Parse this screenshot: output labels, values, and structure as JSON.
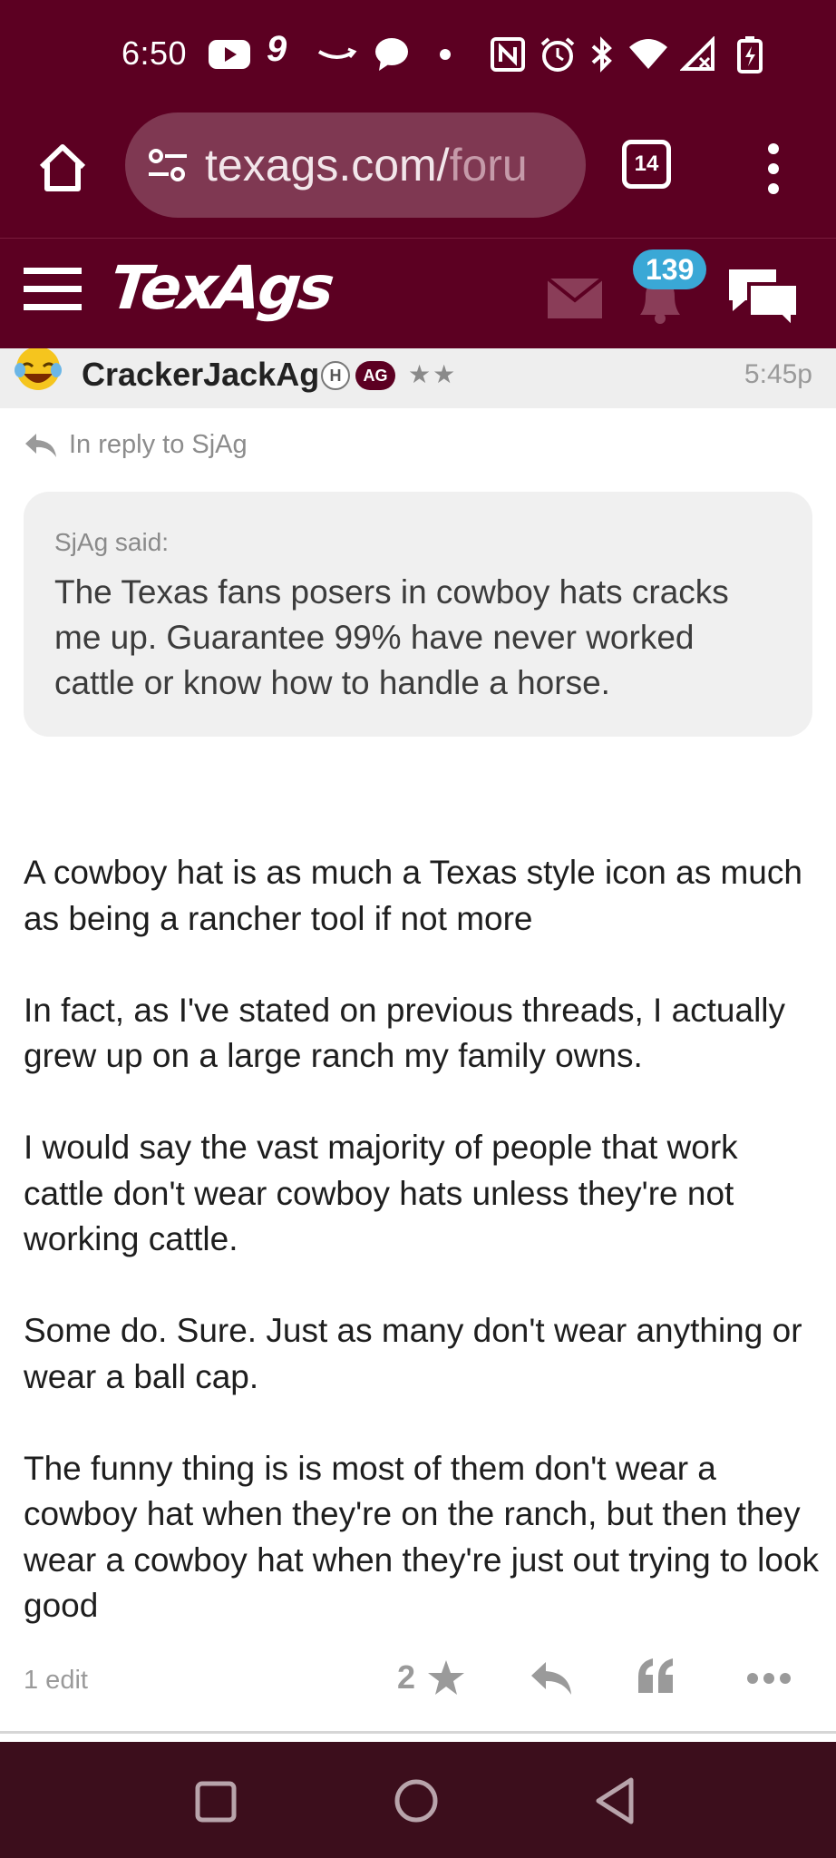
{
  "status_bar": {
    "time": "6:50",
    "icons": [
      "youtube-icon",
      "nine-icon",
      "amazon-icon",
      "chat-bubble-icon",
      "dot-icon",
      "nfc-icon",
      "alarm-icon",
      "bluetooth-icon",
      "wifi-icon",
      "signal-icon",
      "battery-icon"
    ]
  },
  "browser": {
    "url_main": "texags.com/",
    "url_faded": "foru",
    "tab_count": "14"
  },
  "site_header": {
    "logo": "TexAgs",
    "notification_count": "139"
  },
  "post": {
    "username": "CrackerJackAg",
    "badge_h": "H",
    "badge_ag": "AG",
    "rank_stars": "★★",
    "time": "5:45p",
    "reply_to": "In reply to SjAg",
    "quote": {
      "author": "SjAg said:",
      "text": "The Texas fans posers in cowboy hats cracks me up. Guarantee 99% have never worked cattle or know how to handle a horse."
    },
    "paragraphs": [
      "A cowboy hat is as much a Texas style icon as much as being a rancher tool if not more",
      "In fact, as I've stated on previous threads, I actually grew up on a large ranch my family owns.",
      "I would say the vast majority of people that work cattle don't wear cowboy hats unless they're not working cattle.",
      "Some do. Sure. Just as many don't wear anything or wear a ball cap.",
      "The funny thing is is most of them don't wear a cowboy hat when they're on the ranch, but then they wear a cowboy hat when they're just out trying to look good"
    ],
    "edit_count": "1 edit",
    "star_count": "2"
  },
  "colors": {
    "maroon": "#5c0022",
    "badge_blue": "#3aa8d6",
    "nav_bar": "#3c0e1c"
  }
}
